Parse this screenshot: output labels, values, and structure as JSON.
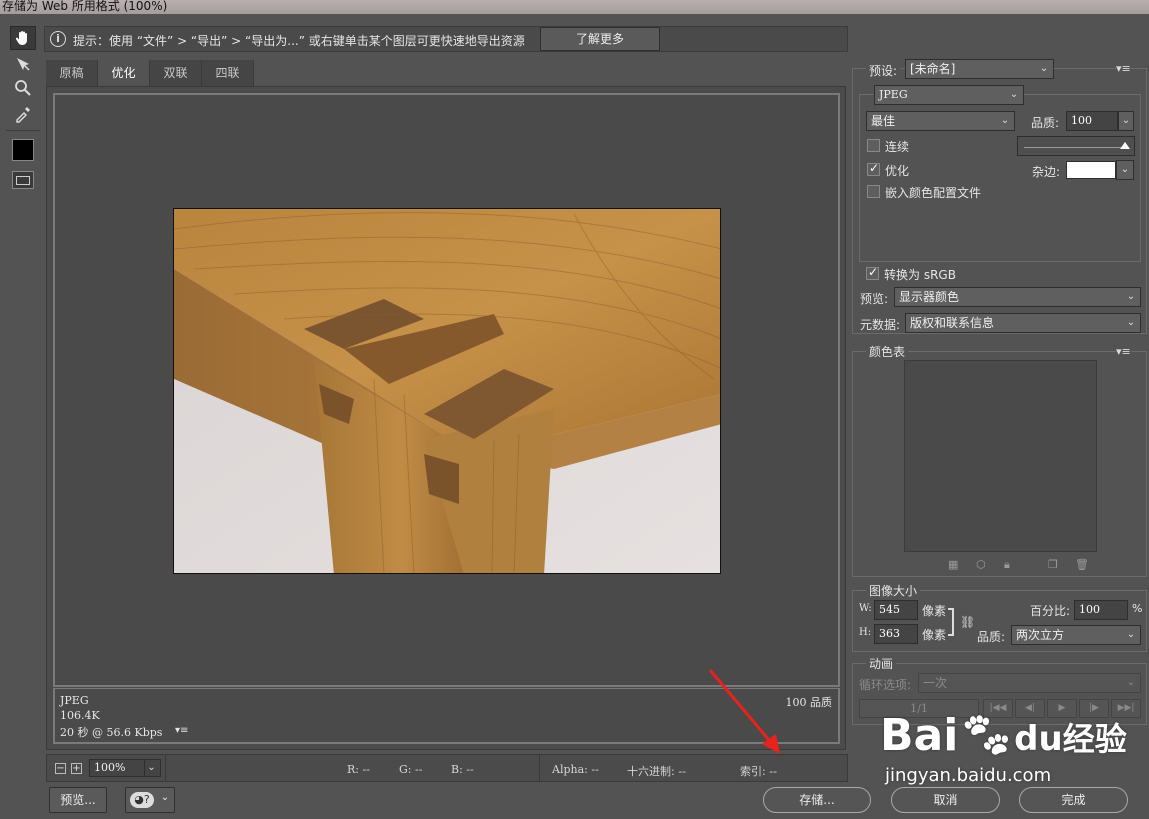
{
  "window": {
    "title": "存储为 Web 所用格式 (100%)"
  },
  "hint": {
    "text": "提示：使用 “文件” > “导出” > “导出为...” 或右键单击某个图层可更快速地导出资源",
    "learn_more": "了解更多"
  },
  "tabs": [
    {
      "label": "原稿"
    },
    {
      "label": "优化"
    },
    {
      "label": "双联"
    },
    {
      "label": "四联"
    }
  ],
  "image_info": {
    "format": "JPEG",
    "size": "106.4K",
    "download_time": "20 秒 @ 56.6 Kbps",
    "quality_label": "100 品质"
  },
  "status": {
    "zoom": "100%",
    "r": "R: --",
    "g": "G: --",
    "b": "B: --",
    "alpha": "Alpha: --",
    "hex": "十六进制: --",
    "index": "索引: --"
  },
  "buttons": {
    "preview": "预览...",
    "save": "存储...",
    "cancel": "取消",
    "done": "完成"
  },
  "preset": {
    "label": "预设:",
    "value": "[未命名]",
    "format": "JPEG",
    "compression": "最佳",
    "quality_label": "品质:",
    "quality_value": "100",
    "progressive": "连续",
    "optimized": "优化",
    "embed_profile": "嵌入颜色配置文件",
    "matte_label": "杂边:",
    "convert_srgb": "转换为 sRGB",
    "preview_label": "预览:",
    "preview_value": "显示器颜色",
    "metadata_label": "元数据:",
    "metadata_value": "版权和联系信息",
    "progressive_checked": false,
    "optimized_checked": true,
    "embed_checked": false,
    "srgb_checked": true
  },
  "color_table": {
    "title": "颜色表"
  },
  "image_size": {
    "title": "图像大小",
    "w_label": "W:",
    "w_value": "545",
    "h_label": "H:",
    "h_value": "363",
    "unit": "像素",
    "percent_label": "百分比:",
    "percent_value": "100",
    "percent_unit": "%",
    "quality_label": "品质:",
    "quality_value": "两次立方"
  },
  "animation": {
    "title": "动画",
    "loop_label": "循环选项:",
    "loop_value": "一次",
    "frame": "1/1"
  },
  "watermark": {
    "brand": "Bai",
    "brand2": "经验",
    "url": "jingyan.baidu.com"
  }
}
